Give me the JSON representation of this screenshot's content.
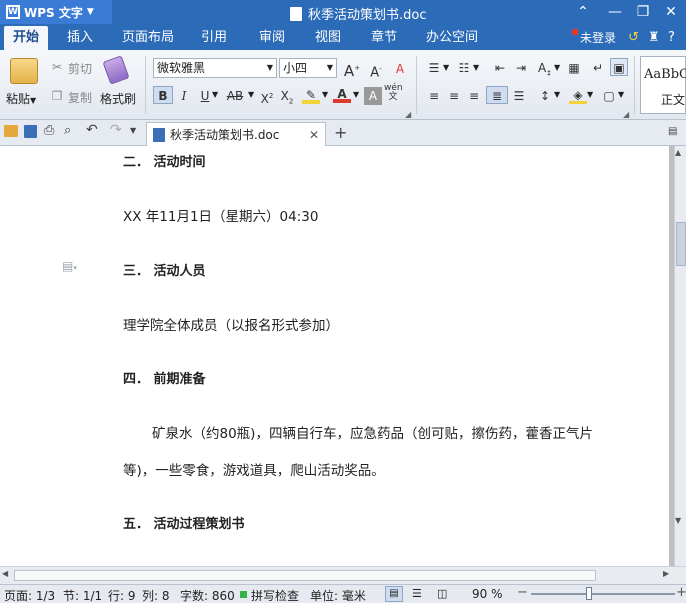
{
  "app": {
    "name": "WPS 文字",
    "doc_title": "秋季活动策划书.doc",
    "login": "未登录"
  },
  "menu": [
    "开始",
    "插入",
    "页面布局",
    "引用",
    "审阅",
    "视图",
    "章节",
    "办公空间"
  ],
  "ribbon": {
    "paste": "粘贴",
    "cut": "剪切",
    "copy": "复制",
    "format_painter": "格式刷",
    "font_name": "微软雅黑",
    "font_size": "小四",
    "style_preview": "AaBbC",
    "style_name": "正文"
  },
  "doc_tab": {
    "title": "秋季活动策划书.doc"
  },
  "document": {
    "h2": "二．   活动时间",
    "time": "XX 年11月1日（星期六）04:30",
    "h3": "三．   活动人员",
    "people": "理学院全体成员（以报名形式参加）",
    "h4": "四．   前期准备",
    "prep1": "矿泉水（约80瓶)，四辆自行车，应急药品（创可贴，擦伤药，藿香正气片",
    "prep2": "等)，一些零食，游戏道具，爬山活动奖品。",
    "h5": "五．   活动过程策划书"
  },
  "status": {
    "page": "页面: 1/3",
    "section": "节: 1/1",
    "row": "行: 9",
    "col": "列: 8",
    "words": "字数: 860",
    "spell": "拼写检查",
    "unit": "单位: 毫米",
    "zoom": "90 %"
  },
  "colors": {
    "title_bar": "#2c6bb8",
    "accent": "#3a7bd5",
    "font_red": "#e03a2f",
    "highlight": "#f3d23a"
  }
}
